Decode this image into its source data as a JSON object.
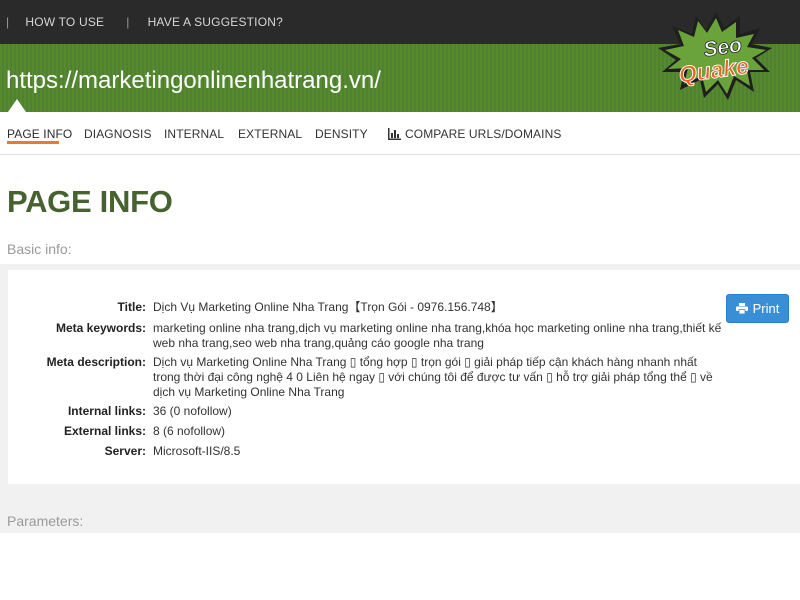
{
  "topnav": {
    "separator": "|",
    "how_to_use": "HOW TO USE",
    "suggestion": "HAVE A SUGGESTION?"
  },
  "header": {
    "url": "https://marketingonlinenhatrang.vn/",
    "logo_line1": "Seo",
    "logo_line2": "Quake"
  },
  "tabs": [
    {
      "label": "PAGE INFO"
    },
    {
      "label": "DIAGNOSIS"
    },
    {
      "label": "INTERNAL"
    },
    {
      "label": "EXTERNAL"
    },
    {
      "label": "DENSITY"
    },
    {
      "label": "COMPARE URLS/DOMAINS"
    }
  ],
  "page": {
    "title": "PAGE INFO",
    "basic_info_label": "Basic info:",
    "parameters_label": "Parameters:"
  },
  "info": {
    "title_label": "Title:",
    "title_value": "Dịch Vụ Marketing Online Nha Trang【Trọn Gói - 0976.156.748】",
    "keywords_label": "Meta keywords:",
    "keywords_value": "marketing online nha trang,dịch vụ marketing online nha trang,khóa học marketing online nha trang,thiết kế web nha trang,seo web nha trang,quảng cáo google nha trang",
    "description_label": "Meta description:",
    "description_value": "Dịch vụ Marketing Online Nha Trang ▯ tổng hợp ▯ trọn gói ▯ giải pháp tiếp cận khách hàng nhanh nhất trong thời đại công nghệ 4 0 Liên hệ ngay ▯ với chúng tôi để được tư vấn ▯ hỗ trợ giải pháp tổng thể ▯ về dịch vụ Marketing Online Nha Trang",
    "internal_label": "Internal links:",
    "internal_value": "36 (0 nofollow)",
    "external_label": "External links:",
    "external_value": "8 (6 nofollow)",
    "server_label": "Server:",
    "server_value": "Microsoft-IIS/8.5"
  },
  "actions": {
    "print_label": "Print"
  }
}
